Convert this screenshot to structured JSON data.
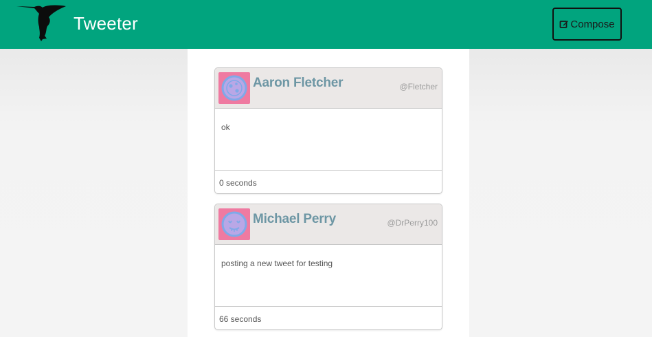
{
  "navbar": {
    "brand": "Tweeter",
    "compose_label": "Compose",
    "background_color": "#01a47e"
  },
  "tweets": [
    {
      "name": "Aaron Fletcher",
      "handle": "@Fletcher",
      "content": "ok",
      "timestamp": "0 seconds",
      "avatar_icon": "robot-face-avatar-icon"
    },
    {
      "name": "Michael Perry",
      "handle": "@DrPerry100",
      "content": "posting a new tweet for testing",
      "timestamp": "66 seconds",
      "avatar_icon": "smiling-face-avatar-icon"
    }
  ],
  "colors": {
    "avatar_bg": "#ef7aa1",
    "author_name": "#6d96a4",
    "header_bg": "#ebe8e7"
  }
}
